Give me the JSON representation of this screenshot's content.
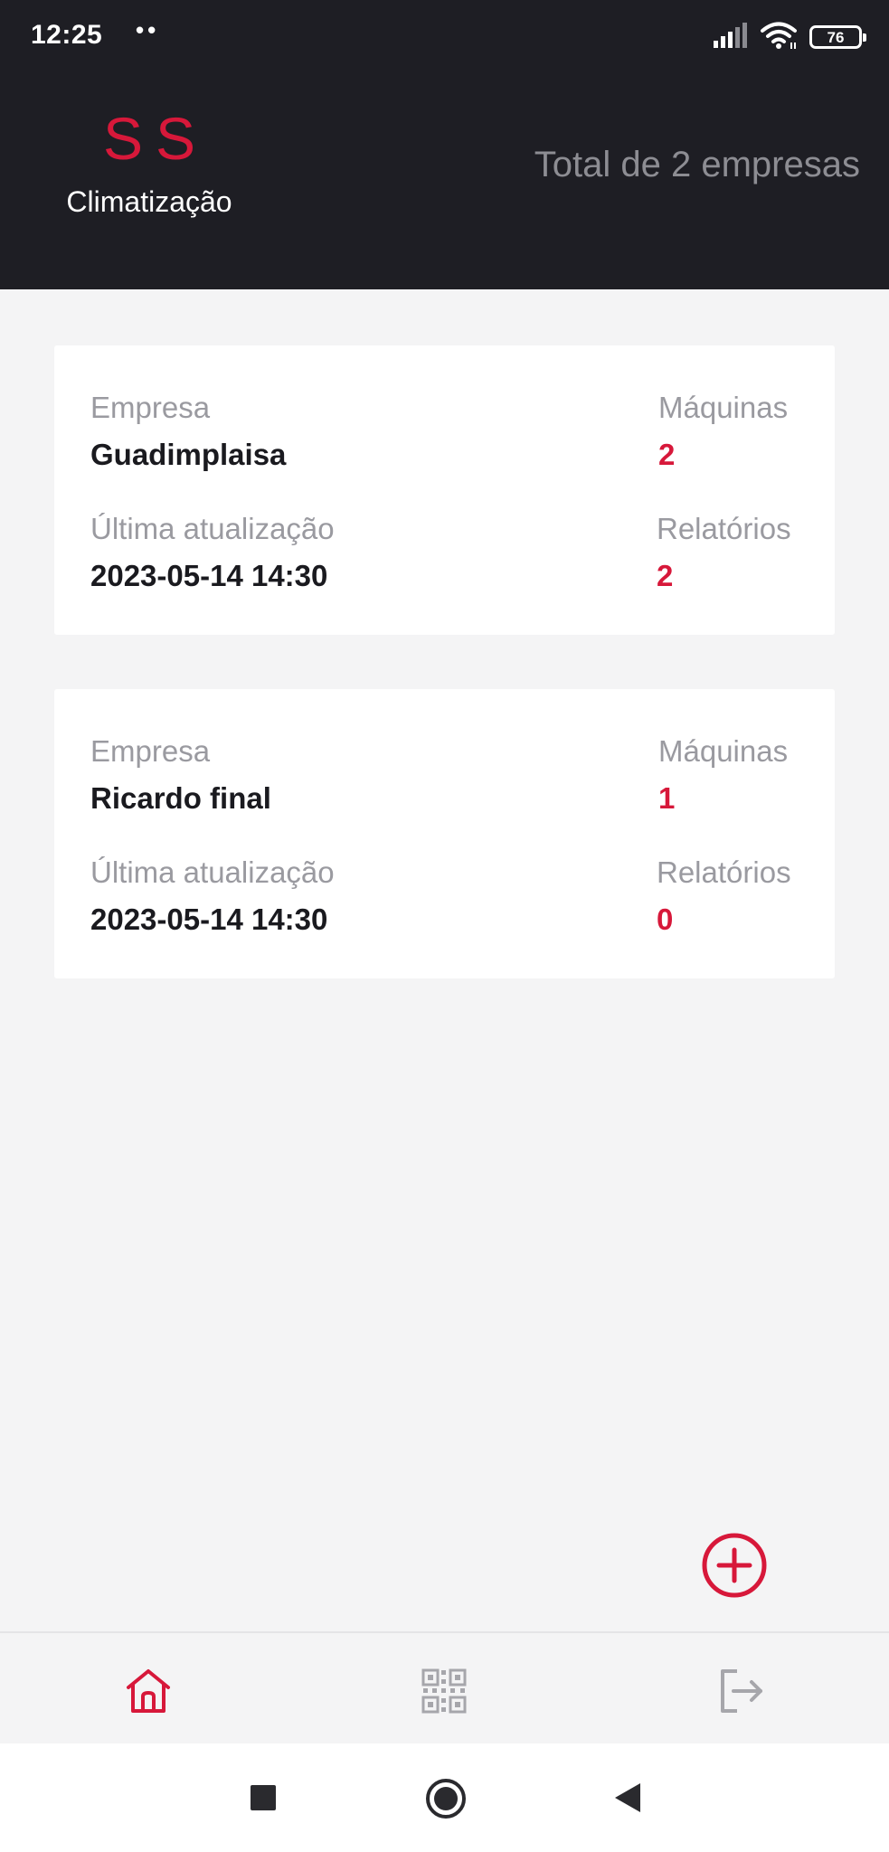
{
  "status_bar": {
    "time": "12:25",
    "notification_dots": "••",
    "battery_level": "76",
    "icons": [
      "signal-icon",
      "wifi-icon",
      "battery-icon"
    ]
  },
  "header": {
    "logo_mark": "SS",
    "logo_subtitle": "Climatização",
    "company_count_text": "Total de 2 empresas"
  },
  "labels": {
    "company": "Empresa",
    "machines": "Máquinas",
    "last_update": "Última atualização",
    "reports": "Relatórios"
  },
  "companies": [
    {
      "name": "Guadimplaisa",
      "machines": "2",
      "last_update": "2023-05-14 14:30",
      "reports": "2"
    },
    {
      "name": "Ricardo final",
      "machines": "1",
      "last_update": "2023-05-14 14:30",
      "reports": "0"
    }
  ],
  "fab": {
    "icon": "add-circle-icon"
  },
  "bottom_nav": {
    "items": [
      {
        "icon": "home-icon",
        "active": true
      },
      {
        "icon": "qr-code-icon",
        "active": false
      },
      {
        "icon": "logout-icon",
        "active": false
      }
    ]
  },
  "system_nav": {
    "icons": [
      "recents-square-icon",
      "home-circle-icon",
      "back-triangle-icon"
    ]
  },
  "colors": {
    "accent": "#d7183a",
    "header_bg": "#1e1e24",
    "page_bg": "#f4f4f5",
    "muted_text": "#9a9aa0",
    "icon_inactive": "#a6a6ab"
  }
}
